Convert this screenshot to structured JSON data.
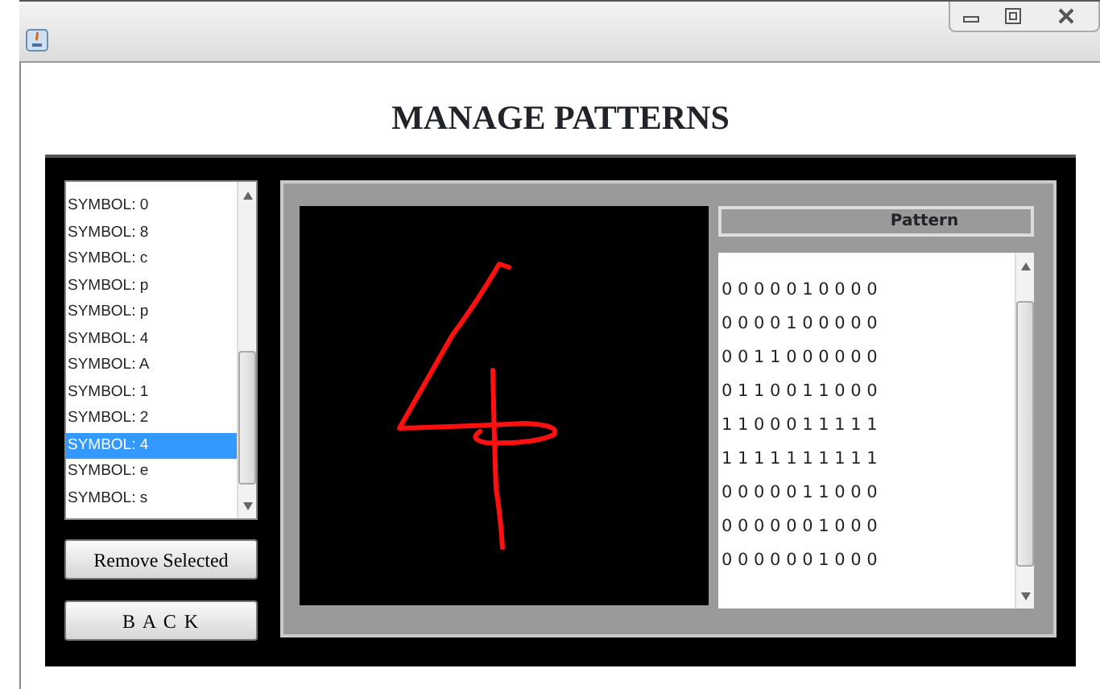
{
  "heading": "MANAGE PATTERNS",
  "symbols": [
    {
      "label": "SYMBOL: 0",
      "selected": false
    },
    {
      "label": "SYMBOL: 8",
      "selected": false
    },
    {
      "label": "SYMBOL: c",
      "selected": false
    },
    {
      "label": "SYMBOL: p",
      "selected": false
    },
    {
      "label": "SYMBOL: p",
      "selected": false
    },
    {
      "label": "SYMBOL: 4",
      "selected": false
    },
    {
      "label": "SYMBOL: A",
      "selected": false
    },
    {
      "label": "SYMBOL: 1",
      "selected": false
    },
    {
      "label": "SYMBOL: 2",
      "selected": false
    },
    {
      "label": "SYMBOL: 4",
      "selected": true
    },
    {
      "label": "SYMBOL: e",
      "selected": false
    },
    {
      "label": "SYMBOL: s",
      "selected": false
    }
  ],
  "buttons": [
    "Remove Selected",
    "B A C K"
  ],
  "pattern_header": "Pattern",
  "pattern_rows": [
    "0 0 0 0 0 1 0 0 0 0",
    "0 0 0 0 1 0 0 0 0 0",
    "0 0 1 1 0 0 0 0 0 0",
    "0 1 1 0 0 1 1 0 0 0",
    "1 1 0 0 0 1 1 1 1 1",
    "1 1 1 1 1 1 1 1 1 1",
    "0 0 0 0 0 1 1 0 0 0",
    "0 0 0 0 0 0 1 0 0 0",
    "0 0 0 0 0 0 1 0 0 0"
  ]
}
